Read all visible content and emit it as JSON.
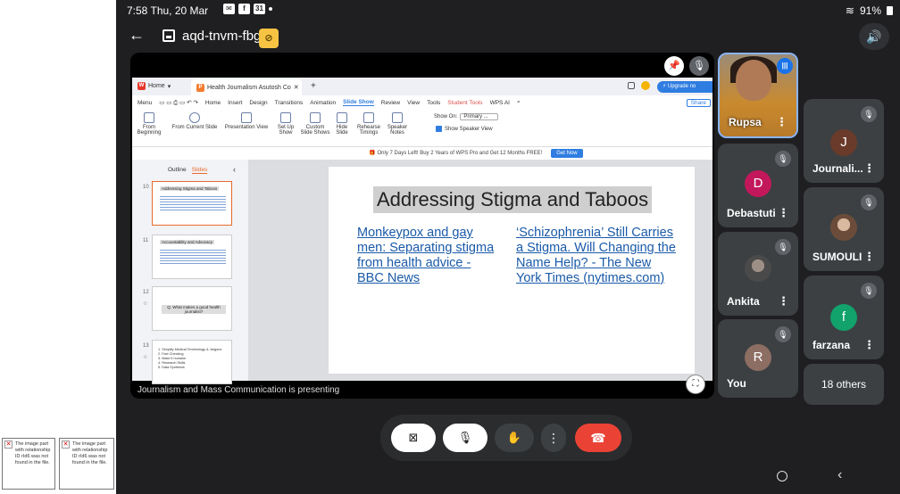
{
  "status_bar": {
    "time": "7:58",
    "date": "Thu, 20 Mar",
    "battery": "91%"
  },
  "meeting": {
    "code": "aqd-tnvm-fbg"
  },
  "wps": {
    "home_tab": "Home",
    "doc_tab": "Health Journalism Asutosh Co",
    "upgrade": "Upgrade no",
    "menu": [
      "Menu",
      "Home",
      "Insert",
      "Design",
      "Transitions",
      "Animation",
      "Slide Show",
      "Review",
      "View",
      "Tools",
      "Student Tools",
      "WPS AI",
      "Share"
    ],
    "ribbon": {
      "from_beginning": "From Beginning",
      "from_current": "From Current Slide",
      "presenter_view": "Presentation View",
      "setup_show": "Set Up Show",
      "custom_shows": "Custom Slide Shows",
      "hide_slide": "Hide Slide",
      "rehearse": "Rehearse Timings",
      "speaker_notes": "Speaker Notes",
      "show_on_label": "Show On:",
      "show_on_value": "Primary ...",
      "show_speaker_view": "Show Speaker View"
    },
    "promo": "Only 7 Days Left! Buy 2 Years of WPS Pro and Get 12 Months FREE!",
    "get_now": "Get Now",
    "pane_tabs": [
      "Outline",
      "Slides"
    ],
    "thumbnails": [
      {
        "num": "10",
        "title": "Addressing Stigma and Taboos"
      },
      {
        "num": "11",
        "title": "Accountability and Advocacy"
      },
      {
        "num": "12",
        "title": "Q. What makes a good health journalist?"
      },
      {
        "num": "13",
        "title": "1. Simplify Medical Terminology & Jargons\n2. Fact Checking\n3. Make it humane\n4. Research Skills\n5. Data Synthesis"
      }
    ],
    "slide": {
      "title": "Addressing Stigma and Taboos",
      "link_left": "Monkeypox and gay men: Separating stigma from health advice - BBC News",
      "link_right": "‘Schizophrenia’ Still Carries a Stigma. Will Changing the Name Help? - The New York Times (nytimes.com)"
    }
  },
  "presenting_label": "Journalism and Mass Communication is presenting",
  "participants": [
    {
      "name": "Rupsa",
      "type": "video"
    },
    {
      "name": "Journali...",
      "initial": "J",
      "color": "#6a3b2a"
    },
    {
      "name": "Debastuti",
      "initial": "D",
      "color": "#c2185b"
    },
    {
      "name": "SUMOULI",
      "type": "photo"
    },
    {
      "name": "Ankita",
      "type": "photo"
    },
    {
      "name": "farzana",
      "initial": "f",
      "color": "#12a26b"
    },
    {
      "name": "You",
      "initial": "R",
      "color": "#8d6e63"
    }
  ],
  "others_label": "18 others"
}
